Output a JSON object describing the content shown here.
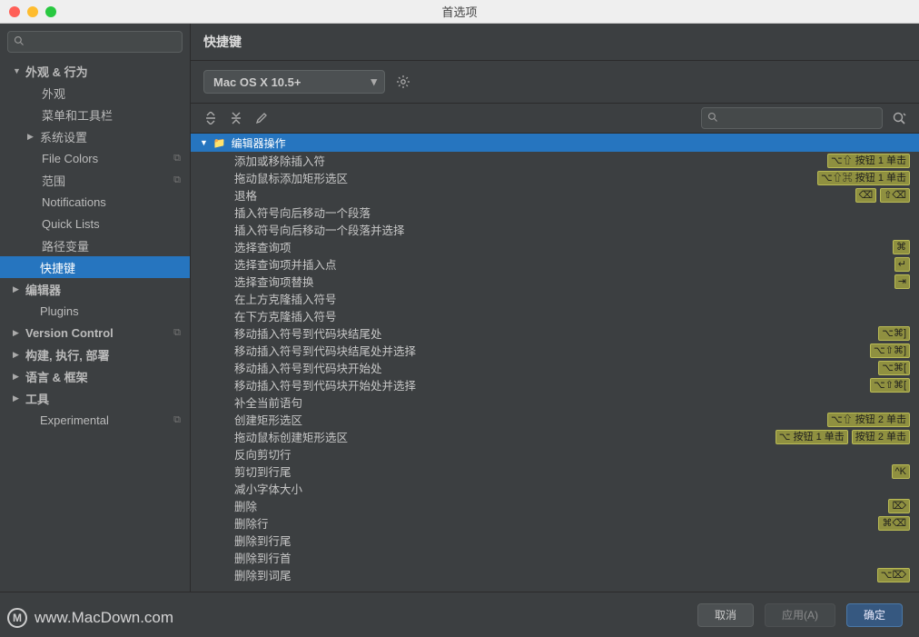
{
  "window": {
    "title": "首选项"
  },
  "sidebar": {
    "search_placeholder": "",
    "items": [
      {
        "label": "外观 & 行为",
        "type": "group",
        "arrow": "▼",
        "children": [
          {
            "label": "外观"
          },
          {
            "label": "菜单和工具栏"
          },
          {
            "label": "系统设置",
            "arrow": "▶"
          },
          {
            "label": "File Colors",
            "badge": "⧉"
          },
          {
            "label": "范围",
            "badge": "⧉"
          },
          {
            "label": "Notifications"
          },
          {
            "label": "Quick Lists"
          },
          {
            "label": "路径变量"
          }
        ]
      },
      {
        "label": "快捷键",
        "selected": true
      },
      {
        "label": "编辑器",
        "type": "group",
        "arrow": "▶"
      },
      {
        "label": "Plugins"
      },
      {
        "label": "Version Control",
        "type": "group",
        "arrow": "▶",
        "badge": "⧉"
      },
      {
        "label": "构建, 执行, 部署",
        "type": "group",
        "arrow": "▶"
      },
      {
        "label": "语言 & 框架",
        "type": "group",
        "arrow": "▶"
      },
      {
        "label": "工具",
        "type": "group",
        "arrow": "▶"
      },
      {
        "label": "Experimental",
        "badge": "⧉"
      }
    ]
  },
  "pane": {
    "title": "快捷键",
    "scheme": "Mac OS X 10.5+",
    "filter_placeholder": "",
    "group_header": "编辑器操作",
    "actions": [
      {
        "label": "添加或移除插入符",
        "shortcuts": [
          "⌥⇧ 按钮 1 单击"
        ]
      },
      {
        "label": "拖动鼠标添加矩形选区",
        "shortcuts": [
          "⌥⇧⌘ 按钮 1 单击"
        ]
      },
      {
        "label": "退格",
        "shortcuts": [
          "⌫",
          "⇧⌫"
        ]
      },
      {
        "label": "插入符号向后移动一个段落",
        "shortcuts": []
      },
      {
        "label": "插入符号向后移动一个段落并选择",
        "shortcuts": []
      },
      {
        "label": "选择查询项",
        "shortcuts": [
          "⌘"
        ]
      },
      {
        "label": "选择查询项并插入点",
        "shortcuts": [
          "↵"
        ]
      },
      {
        "label": "选择查询项替换",
        "shortcuts": [
          "⇥"
        ]
      },
      {
        "label": "在上方克隆插入符号",
        "shortcuts": []
      },
      {
        "label": "在下方克隆插入符号",
        "shortcuts": []
      },
      {
        "label": "移动插入符号到代码块结尾处",
        "shortcuts": [
          "⌥⌘]"
        ]
      },
      {
        "label": "移动插入符号到代码块结尾处并选择",
        "shortcuts": [
          "⌥⇧⌘]"
        ]
      },
      {
        "label": "移动插入符号到代码块开始处",
        "shortcuts": [
          "⌥⌘["
        ]
      },
      {
        "label": "移动插入符号到代码块开始处并选择",
        "shortcuts": [
          "⌥⇧⌘["
        ]
      },
      {
        "label": "补全当前语句",
        "shortcuts": []
      },
      {
        "label": "创建矩形选区",
        "shortcuts": [
          "⌥⇧ 按钮 2 单击"
        ]
      },
      {
        "label": "拖动鼠标创建矩形选区",
        "shortcuts": [
          "⌥ 按钮 1 单击",
          "按钮 2 单击"
        ]
      },
      {
        "label": "反向剪切行",
        "shortcuts": []
      },
      {
        "label": "剪切到行尾",
        "shortcuts": [
          "^K"
        ]
      },
      {
        "label": "减小字体大小",
        "shortcuts": []
      },
      {
        "label": "删除",
        "shortcuts": [
          "⌦"
        ]
      },
      {
        "label": "删除行",
        "shortcuts": [
          "⌘⌫"
        ]
      },
      {
        "label": "删除到行尾",
        "shortcuts": []
      },
      {
        "label": "删除到行首",
        "shortcuts": []
      },
      {
        "label": "删除到词尾",
        "shortcuts": [
          "⌥⌦"
        ]
      }
    ]
  },
  "footer": {
    "cancel": "取消",
    "apply": "应用(A)",
    "ok": "确定"
  },
  "watermark": "www.MacDown.com"
}
